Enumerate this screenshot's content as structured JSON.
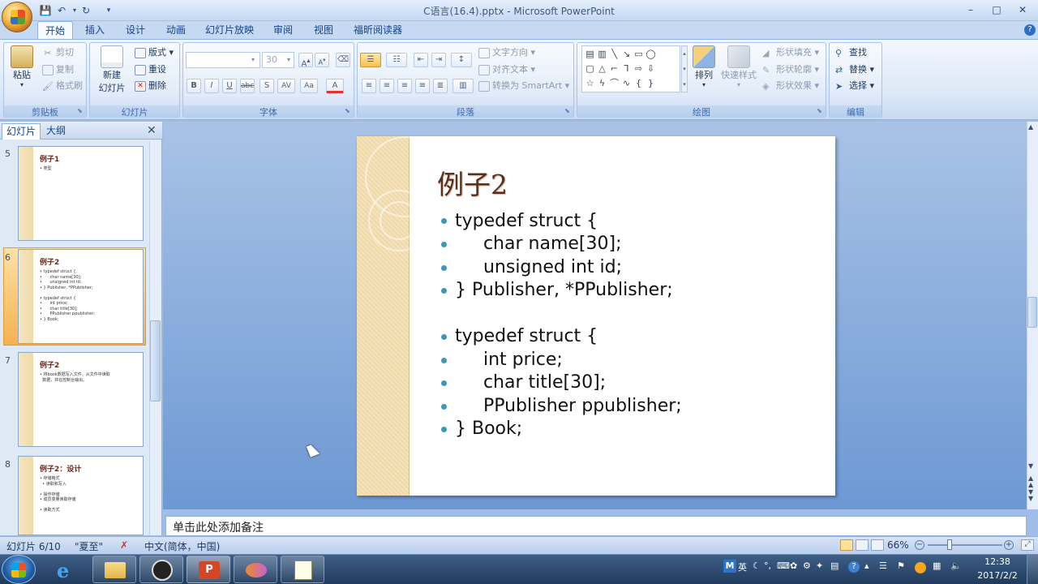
{
  "window": {
    "title": "C语言(16.4).pptx - Microsoft PowerPoint"
  },
  "ribbon_tabs": [
    "开始",
    "插入",
    "设计",
    "动画",
    "幻灯片放映",
    "审阅",
    "视图",
    "福昕阅读器"
  ],
  "clipboard": {
    "paste": "粘贴",
    "cut": "剪切",
    "copy": "复制",
    "format_painter": "格式刷",
    "group": "剪贴板"
  },
  "slides_group": {
    "new_slide_1": "新建",
    "new_slide_2": "幻灯片",
    "layout": "版式",
    "reset": "重设",
    "delete": "删除",
    "group": "幻灯片"
  },
  "font_group": {
    "size": "30",
    "group": "字体"
  },
  "paragraph": {
    "text_direction": "文字方向",
    "align_text": "对齐文本",
    "smartart": "转换为 SmartArt",
    "group": "段落"
  },
  "drawing": {
    "arrange": "排列",
    "quick_styles": "快速样式",
    "shape_fill": "形状填充",
    "shape_outline": "形状轮廓",
    "shape_effects": "形状效果",
    "group": "绘图"
  },
  "editing": {
    "find": "查找",
    "replace": "替换",
    "select": "选择",
    "group": "编辑"
  },
  "left_panel": {
    "tab_slides": "幻灯片",
    "tab_outline": "大纲",
    "thumbs": [
      {
        "num": "5",
        "title": "例子1",
        "body": "• 类型"
      },
      {
        "num": "6",
        "title": "例子2",
        "body": "• typedef struct {\n•      char name[30];\n•      unsigned int id;\n• } Publisher, *PPublisher;\n\n• typedef struct {\n•      int price;\n•      char title[30];\n•      PPublisher ppublisher;\n• } Book;"
      },
      {
        "num": "7",
        "title": "例子2",
        "body": "• 将book数据写入文件，从文件中读取\n  数据，并在控制台输出。"
      },
      {
        "num": "8",
        "title": "例子2：设计",
        "body": "• 存储格式\n  • 读取和写入\n\n• 操作存储\n• 成员变量读取存储\n\n• 读取方式"
      }
    ]
  },
  "slide": {
    "title": "例子2",
    "lines": [
      "typedef struct {",
      "     char name[30];",
      "     unsigned int id;",
      "} Publisher, *PPublisher;",
      "",
      "typedef struct {",
      "     int price;",
      "     char title[30];",
      "     PPublisher ppublisher;",
      "} Book;"
    ]
  },
  "notes": {
    "placeholder": "单击此处添加备注"
  },
  "status": {
    "slide": "幻灯片 6/10",
    "theme": "\"夏至\"",
    "language": "中文(简体，中国)",
    "zoom": "66%"
  },
  "taskbar": {
    "ime": "英",
    "time": "12:38",
    "date": "2017/2/2"
  }
}
